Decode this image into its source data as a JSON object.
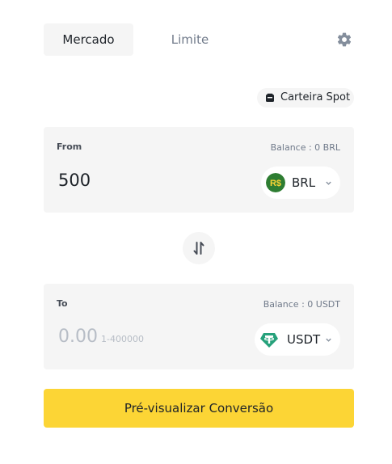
{
  "tabs": [
    {
      "label": "Mercado",
      "active": true
    },
    {
      "label": "Limite",
      "active": false
    }
  ],
  "settings_icon": "gear-icon",
  "wallet": {
    "label": "Carteira Spot",
    "icon": "wallet-icon"
  },
  "from": {
    "label": "From",
    "balance": "Balance : 0 BRL",
    "amount": "500",
    "currency": "BRL",
    "currency_symbol": "R$",
    "currency_color": "#2e7d32"
  },
  "swap_icon": "swap-arrows-icon",
  "to": {
    "label": "To",
    "balance": "Balance : 0 USDT",
    "placeholder": "0.00",
    "range": "1-400000",
    "currency": "USDT",
    "currency_color": "#26a17b"
  },
  "cta": {
    "label": "Pré-visualizar Conversão",
    "color": "#fcd535"
  }
}
